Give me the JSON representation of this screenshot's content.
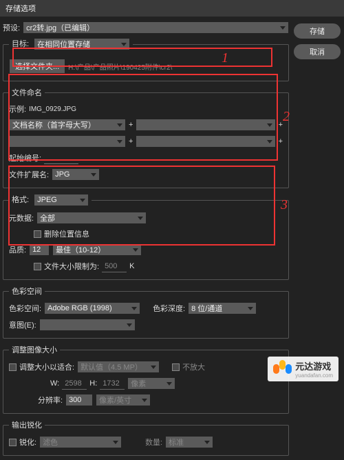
{
  "titlebar": "存储选项",
  "preset": {
    "label": "预设:",
    "value": "cr2转.jpg（已编辑）"
  },
  "buttons": {
    "save": "存储",
    "cancel": "取消"
  },
  "target": {
    "legend": "目标:",
    "mode": "在相同位置存储",
    "folder_btn": "选择文件夹...",
    "path": "H:\\产品\\产品照片\\190425附件\\cr2\\"
  },
  "naming": {
    "legend": "文件命名",
    "example_label": "示例:",
    "example_value": "IMG_0929.JPG",
    "scheme": "文档名称（首字母大写）",
    "start_label": "起始编号:",
    "ext_label": "文件扩展名:",
    "ext_value": "JPG"
  },
  "format": {
    "legend": "格式:",
    "value": "JPEG",
    "meta_label": "元数据:",
    "meta_value": "全部",
    "remove_loc": "删除位置信息",
    "quality_label": "品质:",
    "quality_num": "12",
    "quality_desc": "最佳（10-12）",
    "limit_label": "文件大小限制为:",
    "limit_val": "500",
    "limit_unit": "K"
  },
  "colorspace": {
    "legend": "色彩空间",
    "space_label": "色彩空间:",
    "space_value": "Adobe RGB (1998)",
    "depth_label": "色彩深度:",
    "depth_value": "8 位/通道",
    "intent_label": "意图(E):"
  },
  "resize": {
    "legend": "调整图像大小",
    "fit_label": "调整大小以适合:",
    "fit_value": "默认值（4.5 MP）",
    "noenlarge": "不放大",
    "w": "W:",
    "w_val": "2598",
    "h": "H:",
    "h_val": "1732",
    "unit": "像素",
    "res_label": "分辨率:",
    "res_val": "300",
    "res_unit": "像素/英寸"
  },
  "sharpen": {
    "legend": "输出锐化",
    "label": "锐化:",
    "for": "滤色",
    "amount_label": "数量:",
    "amount_value": "标准"
  },
  "annotations": {
    "n1": "1",
    "n2": "2",
    "n3": "3"
  },
  "watermark": {
    "name": "元达游戏",
    "url": "yuandafan.com"
  }
}
